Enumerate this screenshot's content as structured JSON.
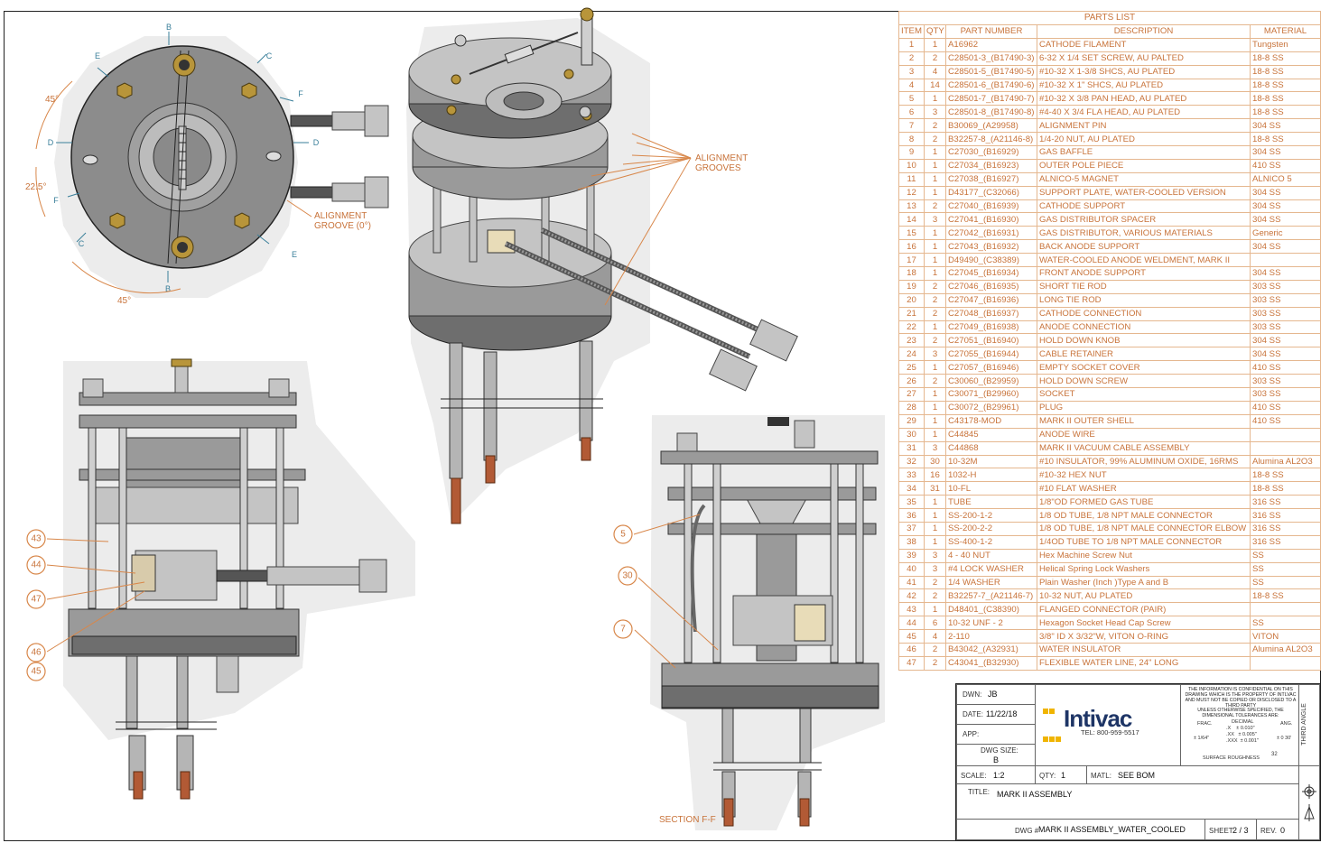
{
  "callouts": {
    "left_view": [
      "43",
      "44",
      "47",
      "46",
      "45"
    ],
    "section_view": [
      "5",
      "30",
      "7"
    ]
  },
  "annotations": {
    "alignment_grooves": "ALIGNMENT\nGROOVES",
    "alignment_groove_0": "ALIGNMENT\nGROOVE (0°)",
    "section_label": "SECTION F-F",
    "angle_45_top": "45°",
    "angle_22_5": "22.5°",
    "angle_45_bottom": "45°"
  },
  "view_letters": [
    "B",
    "B",
    "C",
    "C",
    "D",
    "D",
    "E",
    "E",
    "F",
    "F"
  ],
  "parts_list": {
    "title": "PARTS LIST",
    "columns": [
      "ITEM",
      "QTY",
      "PART NUMBER",
      "DESCRIPTION",
      "MATERIAL"
    ],
    "rows": [
      [
        "1",
        "1",
        "A16962",
        "CATHODE FILAMENT",
        "Tungsten"
      ],
      [
        "2",
        "2",
        "C28501-3_(B17490-3)",
        "6-32 X 1/4 SET SCREW, AU PALTED",
        "18-8 SS"
      ],
      [
        "3",
        "4",
        "C28501-5_(B17490-5)",
        "#10-32 X 1-3/8 SHCS, AU PLATED",
        "18-8 SS"
      ],
      [
        "4",
        "14",
        "C28501-6_(B17490-6)",
        "#10-32 X 1\" SHCS, AU PLATED",
        "18-8 SS"
      ],
      [
        "5",
        "1",
        "C28501-7_(B17490-7)",
        "#10-32 X 3/8 PAN HEAD, AU PLATED",
        "18-8 SS"
      ],
      [
        "6",
        "3",
        "C28501-8_(B17490-8)",
        "#4-40 X 3/4 FLA HEAD, AU PLATED",
        "18-8 SS"
      ],
      [
        "7",
        "2",
        "B30069_(A29958)",
        "ALIGNMENT PIN",
        "304 SS"
      ],
      [
        "8",
        "2",
        "B32257-8_(A21146-8)",
        "1/4-20 NUT, AU PLATED",
        "18-8 SS"
      ],
      [
        "9",
        "1",
        "C27030_(B16929)",
        "GAS BAFFLE",
        "304 SS"
      ],
      [
        "10",
        "1",
        "C27034_(B16923)",
        "OUTER POLE PIECE",
        "410 SS"
      ],
      [
        "11",
        "1",
        "C27038_(B16927)",
        "ALNICO-5 MAGNET",
        "ALNICO 5"
      ],
      [
        "12",
        "1",
        "D43177_(C32066)",
        "SUPPORT PLATE, WATER-COOLED VERSION",
        "304 SS"
      ],
      [
        "13",
        "2",
        "C27040_(B16939)",
        "CATHODE SUPPORT",
        "304 SS"
      ],
      [
        "14",
        "3",
        "C27041_(B16930)",
        "GAS DISTRIBUTOR SPACER",
        "304 SS"
      ],
      [
        "15",
        "1",
        "C27042_(B16931)",
        "GAS DISTRIBUTOR, VARIOUS MATERIALS",
        "Generic"
      ],
      [
        "16",
        "1",
        "C27043_(B16932)",
        "BACK ANODE SUPPORT",
        "304 SS"
      ],
      [
        "17",
        "1",
        "D49490_(C38389)",
        "WATER-COOLED ANODE WELDMENT, MARK II",
        ""
      ],
      [
        "18",
        "1",
        "C27045_(B16934)",
        "FRONT ANODE SUPPORT",
        "304 SS"
      ],
      [
        "19",
        "2",
        "C27046_(B16935)",
        "SHORT TIE ROD",
        "303 SS"
      ],
      [
        "20",
        "2",
        "C27047_(B16936)",
        "LONG TIE ROD",
        "303 SS"
      ],
      [
        "21",
        "2",
        "C27048_(B16937)",
        "CATHODE CONNECTION",
        "303 SS"
      ],
      [
        "22",
        "1",
        "C27049_(B16938)",
        "ANODE CONNECTION",
        "303 SS"
      ],
      [
        "23",
        "2",
        "C27051_(B16940)",
        "HOLD DOWN KNOB",
        "304 SS"
      ],
      [
        "24",
        "3",
        "C27055_(B16944)",
        "CABLE RETAINER",
        "304 SS"
      ],
      [
        "25",
        "1",
        "C27057_(B16946)",
        "EMPTY SOCKET COVER",
        "410 SS"
      ],
      [
        "26",
        "2",
        "C30060_(B29959)",
        "HOLD DOWN SCREW",
        "303 SS"
      ],
      [
        "27",
        "1",
        "C30071_(B29960)",
        "SOCKET",
        "303 SS"
      ],
      [
        "28",
        "1",
        "C30072_(B29961)",
        "PLUG",
        "410 SS"
      ],
      [
        "29",
        "1",
        "C43178-MOD",
        "MARK II OUTER SHELL",
        "410 SS"
      ],
      [
        "30",
        "1",
        "C44845",
        "ANODE WIRE",
        ""
      ],
      [
        "31",
        "3",
        "C44868",
        "MARK II VACUUM CABLE ASSEMBLY",
        ""
      ],
      [
        "32",
        "30",
        "10-32M",
        "#10 INSULATOR, 99% ALUMINUM OXIDE, 16RMS",
        "Alumina AL2O3"
      ],
      [
        "33",
        "16",
        "1032-H",
        "#10-32 HEX NUT",
        "18-8 SS"
      ],
      [
        "34",
        "31",
        "10-FL",
        "#10 FLAT WASHER",
        "18-8 SS"
      ],
      [
        "35",
        "1",
        "TUBE",
        "1/8\"OD FORMED GAS TUBE",
        "316 SS"
      ],
      [
        "36",
        "1",
        "SS-200-1-2",
        "1/8 OD TUBE, 1/8 NPT MALE CONNECTOR",
        "316 SS"
      ],
      [
        "37",
        "1",
        "SS-200-2-2",
        "1/8 OD TUBE, 1/8 NPT MALE CONNECTOR ELBOW",
        "316 SS"
      ],
      [
        "38",
        "1",
        "SS-400-1-2",
        "1/4OD TUBE TO 1/8 NPT MALE CONNECTOR",
        "316 SS"
      ],
      [
        "39",
        "3",
        "4 - 40 NUT",
        "Hex Machine Screw Nut",
        "SS"
      ],
      [
        "40",
        "3",
        "#4 LOCK WASHER",
        "Helical Spring Lock Washers",
        "SS"
      ],
      [
        "41",
        "2",
        "1/4 WASHER",
        "Plain Washer (Inch )Type A and B",
        "SS"
      ],
      [
        "42",
        "2",
        "B32257-7_(A21146-7)",
        "10-32 NUT, AU PLATED",
        "18-8 SS"
      ],
      [
        "43",
        "1",
        "D48401_(C38390)",
        "FLANGED CONNECTOR (PAIR)",
        ""
      ],
      [
        "44",
        "6",
        "10-32 UNF - 2",
        "Hexagon Socket Head Cap Screw",
        "SS"
      ],
      [
        "45",
        "4",
        "2-110",
        "3/8\" ID X 3/32\"W, VITON O-RING",
        "VITON"
      ],
      [
        "46",
        "2",
        "B43042_(A32931)",
        "WATER INSULATOR",
        "Alumina AL2O3"
      ],
      [
        "47",
        "2",
        "C43041_(B32930)",
        "FLEXIBLE WATER LINE, 24\" LONG",
        ""
      ]
    ]
  },
  "title_block": {
    "dwn_label": "DWN:",
    "dwn_value": "JB",
    "date_label": "DATE:",
    "date_value": "11/22/18",
    "app_label": "APP:",
    "dwg_size_label": "DWG SIZE:",
    "dwg_size_value": "B",
    "company": "Intivac",
    "tel": "TEL: 800-959-5517",
    "confidential": "THE INFORMATION IS CONFIDENTIAL ON THIS DRAWING WHICH IS THE PROPERTY OF INTLVAC AND MUST NOT BE COPIED OR DISCLOSED TO A THIRD PARTY",
    "tolerance_note": "UNLESS OTHERWISE SPECIFIED, THE DIMENSIONAL TOLERANCES ARE:",
    "frac_label": "FRAC.",
    "frac_value": "± 1/64\"",
    "decimal_label": "DECIMAL",
    "decimal_x": ".X    ± 0.010\"",
    "decimal_xx": ".XX   ± 0.005\"",
    "decimal_xxx": ".XXX  ± 0.001\"",
    "ang_label": "ANG.",
    "ang_value": "± 0 30'",
    "surface_roughness": "SURFACE ROUGHNESS",
    "surface_value": "32",
    "third_angle": "THIRD ANGLE",
    "scale_label": "SCALE:",
    "scale_value": "1:2",
    "qty_label": "QTY:",
    "qty_value": "1",
    "matl_label": "MATL:",
    "matl_value": "SEE BOM",
    "title_label": "TITLE:",
    "title_value": "MARK II ASSEMBLY",
    "dwg_label": "DWG #",
    "dwg_value": "MARK II ASSEMBLY_WATER_COOLED",
    "sheet_label": "SHEET:",
    "sheet_value": "2 / 3",
    "rev_label": "REV.",
    "rev_value": "0"
  }
}
